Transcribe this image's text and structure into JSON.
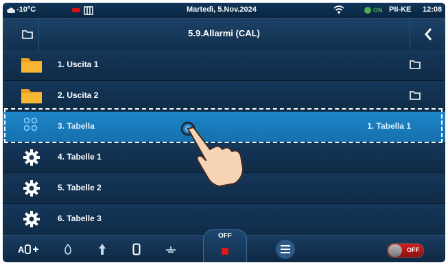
{
  "status_bar": {
    "temperature": "-10°C",
    "date": "Martedì, 5.Nov.2024",
    "fan_state": "ON",
    "device": "PII-KE",
    "time": "12:08"
  },
  "header": {
    "title": "5.9.Allarmi (CAL)"
  },
  "list": {
    "items": [
      {
        "label": "1. Uscita 1",
        "value": ""
      },
      {
        "label": "2. Uscita 2",
        "value": ""
      },
      {
        "label": "3. Tabella",
        "value": "1. Tabella 1"
      },
      {
        "label": "4. Tabelle 1",
        "value": ""
      },
      {
        "label": "5. Tabelle 2",
        "value": ""
      },
      {
        "label": "6. Tabelle 3",
        "value": ""
      }
    ]
  },
  "bottom_bar": {
    "off_label": "OFF",
    "toggle_label": "OFF"
  },
  "colors": {
    "background": "#0d2238",
    "selected_row": "#1a7fc0",
    "folder": "#f0a020",
    "off_red": "#e01818"
  }
}
